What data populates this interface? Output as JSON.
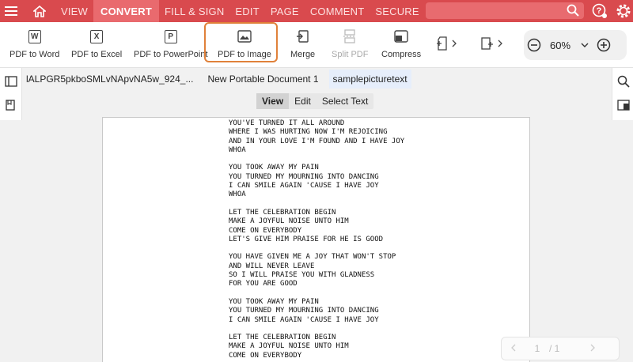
{
  "nav": {
    "tabs": [
      "VIEW",
      "CONVERT",
      "FILL & SIGN",
      "EDIT",
      "PAGE",
      "COMMENT",
      "SECURE"
    ]
  },
  "toolbar": {
    "pdf_to_word": "PDF to Word",
    "pdf_to_word_glyph": "W",
    "pdf_to_excel": "PDF to Excel",
    "pdf_to_excel_glyph": "X",
    "pdf_to_ppt": "PDF to PowerPoint",
    "pdf_to_ppt_glyph": "P",
    "pdf_to_image": "PDF to Image",
    "merge": "Merge",
    "split": "Split PDF",
    "compress": "Compress"
  },
  "zoom": {
    "value": "60%"
  },
  "doc_tabs": [
    "lALPGR5pkboSMLvNApvNA5w_924_...",
    "New Portable Document 1",
    "samplepicturetext"
  ],
  "modes": [
    "View",
    "Edit",
    "Select Text"
  ],
  "document": {
    "text": "YOU'VE TURNED IT ALL AROUND\nWHERE I WAS HURTING NOW I'M REJOICING\nAND IN YOUR LOVE I'M FOUND AND I HAVE JOY\nWHOA\n\nYOU TOOK AWAY MY PAIN\nYOU TURNED MY MOURNING INTO DANCING\nI CAN SMILE AGAIN 'CAUSE I HAVE JOY\nWHOA\n\nLET THE CELEBRATION BEGIN\nMAKE A JOYFUL NOISE UNTO HIM\nCOME ON EVERYBODY\nLET'S GIVE HIM PRAISE FOR HE IS GOOD\n\nYOU HAVE GIVEN ME A JOY THAT WON'T STOP\nAND WILL NEVER LEAVE\nSO I WILL PRAISE YOU WITH GLADNESS\nFOR YOU ARE GOOD\n\nYOU TOOK AWAY MY PAIN\nYOU TURNED MY MOURNING INTO DANCING\nI CAN SMILE AGAIN 'CAUSE I HAVE JOY\n\nLET THE CELEBRATION BEGIN\nMAKE A JOYFUL NOISE UNTO HIM\nCOME ON EVERYBODY"
  },
  "pager": {
    "current": "1",
    "total": "/ 1"
  },
  "colors": {
    "brand": "#d94a4e",
    "highlight": "#e0813a",
    "active_tab_bg": "#e6eefb"
  }
}
